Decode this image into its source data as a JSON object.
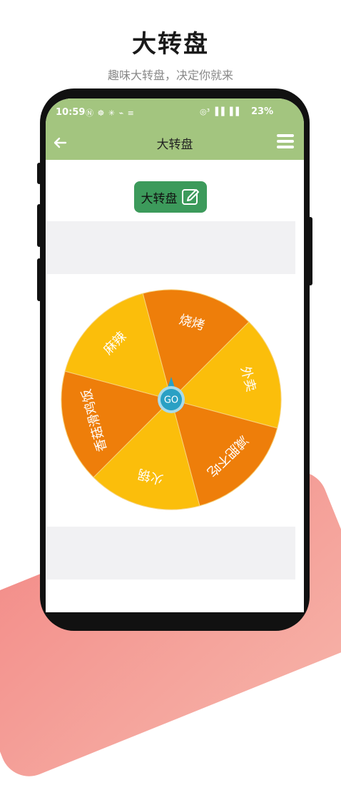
{
  "promo": {
    "title": "大转盘",
    "subtitle": "趣味大转盘，决定你就来"
  },
  "status_bar": {
    "time": "10:59",
    "icons_left": "Ⓝ ☸ ✳ ⌁ ≡",
    "signal": "◎³ ▐▐ ▐▐",
    "battery": "23%"
  },
  "app_bar": {
    "title": "大转盘",
    "back_icon": "arrow-left-icon",
    "menu_icon": "menu-icon"
  },
  "wheel_name_button": {
    "label": "大转盘",
    "icon": "edit-icon"
  },
  "wheel": {
    "center_label": "GO",
    "segments": [
      {
        "label": "烧烤",
        "color": "#ee7e0a"
      },
      {
        "label": "外卖",
        "color": "#fbbe0b"
      },
      {
        "label": "减肥不吃",
        "color": "#ee7e0a"
      },
      {
        "label": "火锅",
        "color": "#fbbe0b"
      },
      {
        "label": "香菇滑鸡饭",
        "color": "#ee7e0a"
      },
      {
        "label": "麻辣",
        "color": "#fbbe0b"
      }
    ]
  },
  "colors": {
    "app_bar": "#a3c57f",
    "button": "#3c9a5b",
    "orange": "#ee7e0a",
    "yellow": "#fbbe0b",
    "go_button": "#2aa0c4"
  }
}
